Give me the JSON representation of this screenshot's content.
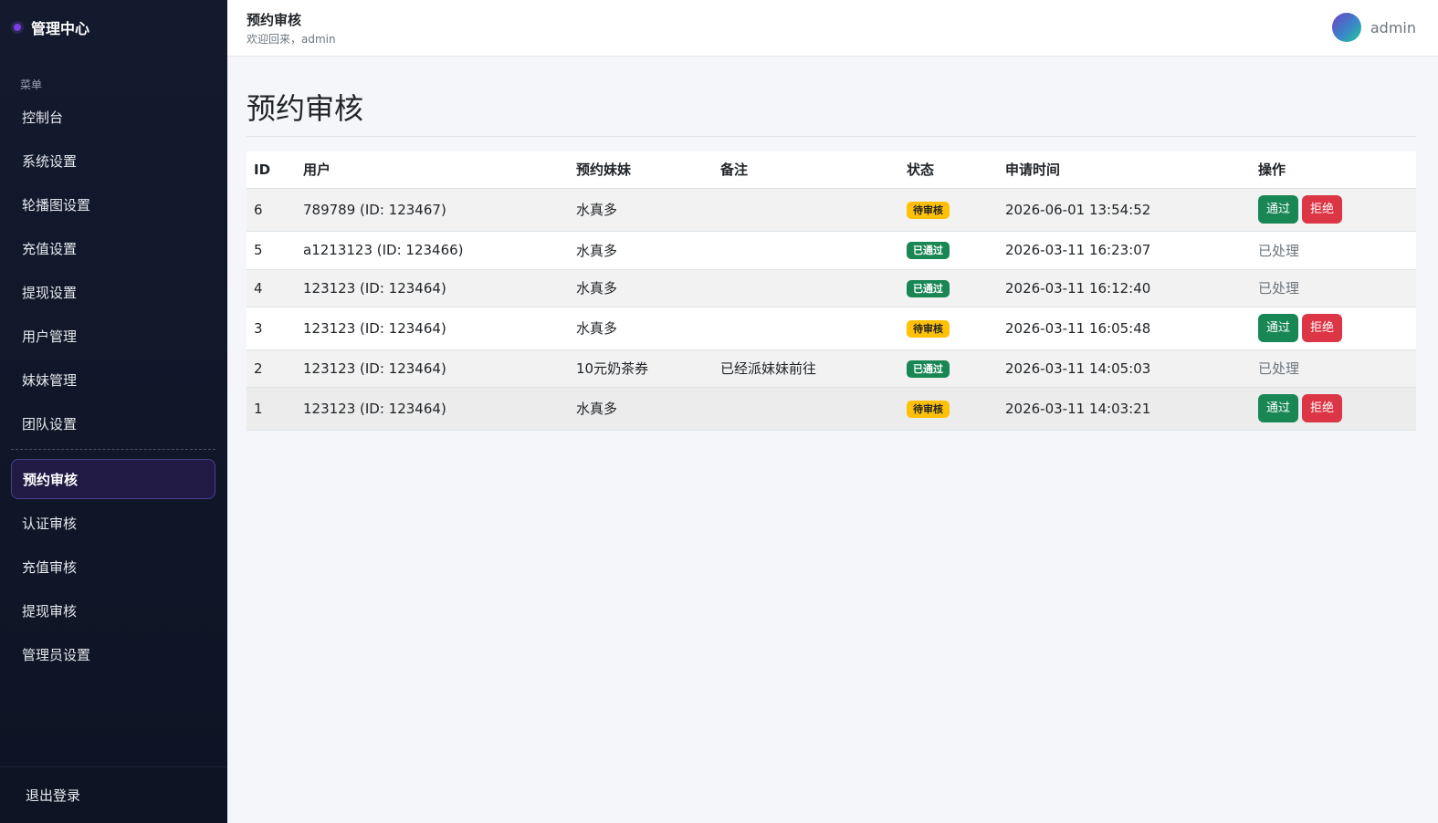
{
  "sidebar": {
    "brand": "管理中心",
    "caption": "菜单",
    "items_top": [
      "控制台",
      "系统设置",
      "轮播图设置",
      "充值设置",
      "提现设置",
      "用户管理",
      "妹妹管理",
      "团队设置"
    ],
    "items_bottom": [
      "预约审核",
      "认证审核",
      "充值审核",
      "提现审核",
      "管理员设置"
    ],
    "active": "预约审核",
    "logout": "退出登录"
  },
  "header": {
    "title": "预约审核",
    "subtitle": "欢迎回来，admin",
    "username": "admin"
  },
  "main": {
    "title": "预约审核",
    "columns": [
      "ID",
      "用户",
      "预约妹妹",
      "备注",
      "状态",
      "申请时间",
      "操作"
    ],
    "rows": [
      {
        "id": "6",
        "user": "789789 (ID: 123467)",
        "girl": "水真多",
        "note": "",
        "status": "待审核",
        "time": "2026-06-01 13:54:52",
        "pending": true
      },
      {
        "id": "5",
        "user": "a1213123 (ID: 123466)",
        "girl": "水真多",
        "note": "",
        "status": "已通过",
        "time": "2026-03-11 16:23:07",
        "pending": false
      },
      {
        "id": "4",
        "user": "123123 (ID: 123464)",
        "girl": "水真多",
        "note": "",
        "status": "已通过",
        "time": "2026-03-11 16:12:40",
        "pending": false
      },
      {
        "id": "3",
        "user": "123123 (ID: 123464)",
        "girl": "水真多",
        "note": "",
        "status": "待审核",
        "time": "2026-03-11 16:05:48",
        "pending": true
      },
      {
        "id": "2",
        "user": "123123 (ID: 123464)",
        "girl": "10元奶茶券",
        "note": "已经派妹妹前往",
        "status": "已通过",
        "time": "2026-03-11 14:05:03",
        "pending": false
      },
      {
        "id": "1",
        "user": "123123 (ID: 123464)",
        "girl": "水真多",
        "note": "",
        "status": "待审核",
        "time": "2026-03-11 14:03:21",
        "pending": true
      }
    ],
    "approve_label": "通过",
    "reject_label": "拒绝",
    "processed_label": "已处理"
  },
  "colors": {
    "approve": "#198754",
    "reject": "#dc3545",
    "pending_badge": "#ffc107",
    "active_item_bg": "#201a45"
  }
}
